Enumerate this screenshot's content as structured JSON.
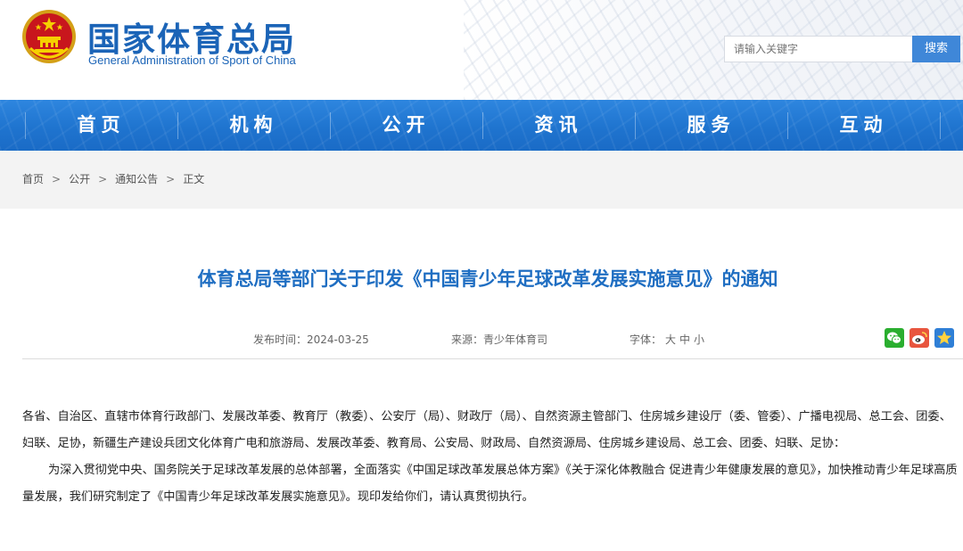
{
  "header": {
    "site_title": "国家体育总局",
    "site_subtitle": "General Administration of Sport of China",
    "search_placeholder": "请输入关键字",
    "search_button": "搜索"
  },
  "nav": {
    "items": [
      {
        "label": "首页"
      },
      {
        "label": "机构"
      },
      {
        "label": "公开"
      },
      {
        "label": "资讯"
      },
      {
        "label": "服务"
      },
      {
        "label": "互动"
      }
    ]
  },
  "breadcrumb": {
    "items": [
      "首页",
      "公开",
      "通知公告",
      "正文"
    ],
    "separator": ">"
  },
  "article": {
    "title": "体育总局等部门关于印发《中国青少年足球改革发展实施意见》的通知",
    "publish_label": "发布时间：",
    "publish_date": "2024-03-25",
    "source_label": "来源：",
    "source": "青少年体育司",
    "font_label": "字体：",
    "font_sizes": [
      "大",
      "中",
      "小"
    ],
    "share": [
      {
        "icon": "wechat-icon",
        "color": "#2aae2f"
      },
      {
        "icon": "weibo-icon",
        "color": "#e8553e"
      },
      {
        "icon": "favorite-star-icon",
        "color": "#2f7fd6"
      }
    ],
    "addressee": "各省、自治区、直辖市体育行政部门、发展改革委、教育厅（教委）、公安厅（局）、财政厅（局）、自然资源主管部门、住房城乡建设厅（委、管委）、广播电视局、总工会、团委、妇联、足协，新疆生产建设兵团文化体育广电和旅游局、发展改革委、教育局、公安局、财政局、自然资源局、住房城乡建设局、总工会、团委、妇联、足协：",
    "paragraph_1": "为深入贯彻党中央、国务院关于足球改革发展的总体部署，全面落实《中国足球改革发展总体方案》《关于深化体教融合 促进青少年健康发展的意见》，加快推动青少年足球高质量发展，我们研究制定了《中国青少年足球改革发展实施意见》。现印发给你们，请认真贯彻执行。"
  },
  "colors": {
    "brand_blue": "#1b64b7",
    "nav_blue": "#1f74cf",
    "title_blue": "#1f6ec2",
    "search_button": "#3f87d8"
  }
}
